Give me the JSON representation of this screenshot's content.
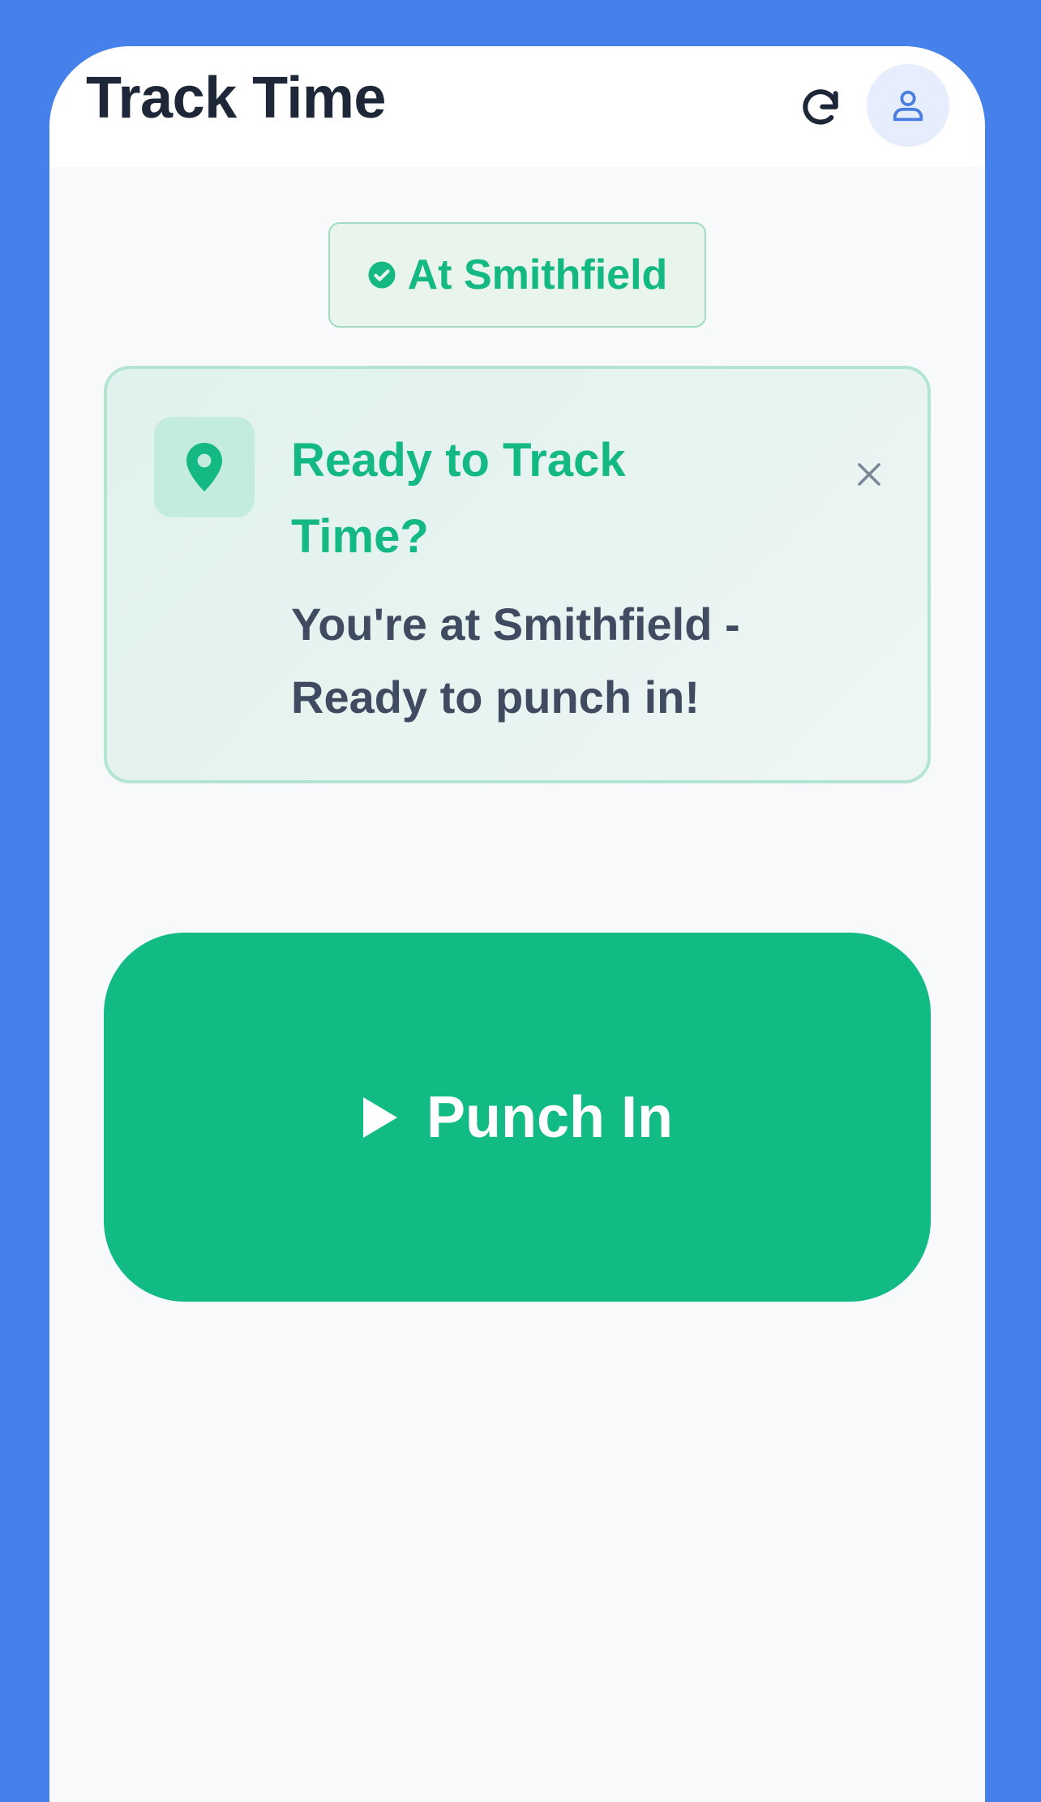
{
  "header": {
    "title": "Track Time",
    "refresh_icon": "refresh-icon",
    "profile_icon": "user-icon"
  },
  "location_badge": {
    "icon": "check-circle-icon",
    "label": "At Smithfield"
  },
  "prompt_card": {
    "icon": "location-pin-icon",
    "title": "Ready to Track Time?",
    "message": "You're at Smithfield - Ready to punch in!",
    "close_icon": "close-icon"
  },
  "punch_button": {
    "icon": "play-icon",
    "label": "Punch In"
  },
  "colors": {
    "background": "#4681EB",
    "accent_green": "#13B883",
    "button_green": "#12BA84",
    "title_dark": "#1D2738",
    "message_text": "#3F4B60",
    "avatar_bg": "#E6EDFD"
  }
}
